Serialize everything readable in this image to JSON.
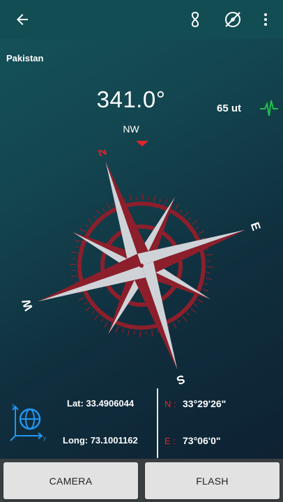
{
  "toolbar": {
    "back_icon": "arrow-left-icon",
    "calibrate_icon": "figure-eight-icon",
    "compass_icon": "compass-off-icon",
    "menu_icon": "more-vert-icon"
  },
  "location": "Pakistan",
  "heading": {
    "degrees": "341.0°",
    "direction": "NW"
  },
  "magnetic": {
    "value": "65 ut",
    "icon": "pulse-icon",
    "icon_color": "#1fc24a"
  },
  "compass": {
    "labels": {
      "north": "N",
      "east": "E",
      "south": "S",
      "west": "W"
    },
    "rose_color": "#8c1f2b",
    "needle_color": "#cfd3d8",
    "north_color": "#d6262e"
  },
  "coordinates": {
    "globe_icon": "globe-axes-icon",
    "lat": "Lat: 33.4906044",
    "lng": "Long: 73.1001162",
    "n_label": "N :",
    "n_value": "33°29'26\"",
    "e_label": "E :",
    "e_value": "73°06'0\""
  },
  "buttons": {
    "camera": "CAMERA",
    "flash": "FLASH"
  },
  "colors": {
    "toolbar": "#134d54",
    "accent_red": "#e0242b",
    "globe_blue": "#2196f3"
  }
}
